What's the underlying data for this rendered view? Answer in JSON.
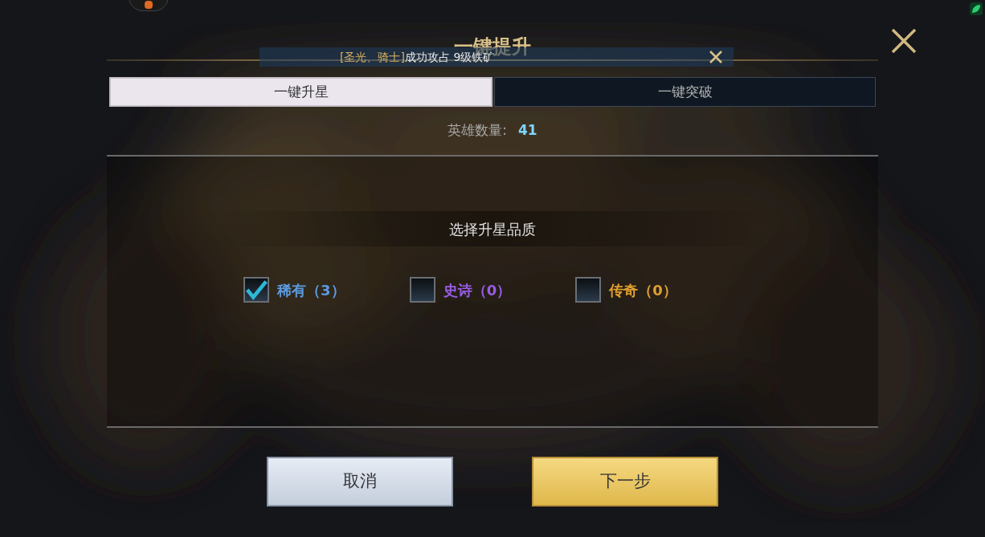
{
  "title": "一键提升",
  "notice": {
    "faction": "[圣光、骑士]",
    "text": "成功攻占 9级铁矿"
  },
  "tabs": [
    {
      "label": "一键升星",
      "selected": true
    },
    {
      "label": "一键突破",
      "selected": false
    }
  ],
  "hero_count": {
    "label": "英雄数量:",
    "value": "41"
  },
  "quality_heading": "选择升星品质",
  "options": [
    {
      "label": "稀有（3）",
      "checked": true,
      "color": "#5b9be0"
    },
    {
      "label": "史诗（0）",
      "checked": false,
      "color": "#9a5ce6"
    },
    {
      "label": "传奇（0）",
      "checked": false,
      "color": "#e0a030"
    }
  ],
  "buttons": [
    {
      "label": "取消",
      "kind": "secondary"
    },
    {
      "label": "下一步",
      "kind": "primary"
    }
  ]
}
